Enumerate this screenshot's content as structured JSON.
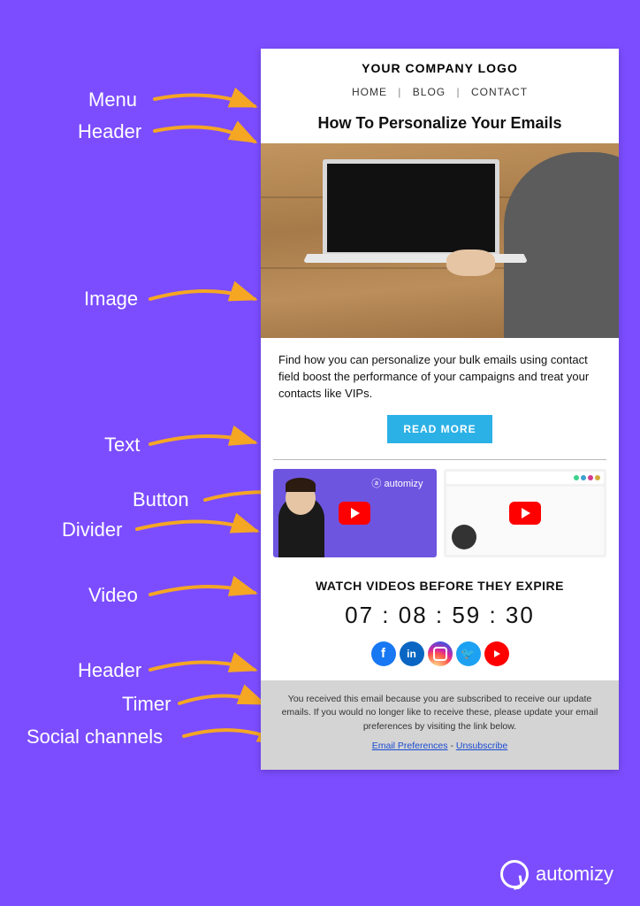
{
  "annotations": {
    "menu": "Menu",
    "header": "Header",
    "image": "Image",
    "text": "Text",
    "button": "Button",
    "divider": "Divider",
    "video": "Video",
    "header2": "Header",
    "timer": "Timer",
    "social": "Social channels"
  },
  "email": {
    "logo": "YOUR COMPANY LOGO",
    "menu": {
      "home": "HOME",
      "blog": "BLOG",
      "contact": "CONTACT"
    },
    "headline": "How To Personalize Your Emails",
    "body": "Find how you can personalize your bulk emails using contact field boost the performance of your campaigns and treat your contacts like VIPs.",
    "button": "READ MORE",
    "video1_logo": "automizy",
    "sub_headline": "WATCH VIDEOS BEFORE THEY EXPIRE",
    "timer": "07 : 08 : 59 : 30",
    "footer_text": "You received this email because you are subscribed to receive our update emails. If you would no longer like to receive these, please update your email preferences by visiting the link below.",
    "footer_link1": "Email Preferences",
    "footer_sep": " - ",
    "footer_link2": "Unsubscribe"
  },
  "social_glyphs": {
    "fb": "f",
    "li": "in",
    "tw": "🐦"
  },
  "brand": "automizy"
}
